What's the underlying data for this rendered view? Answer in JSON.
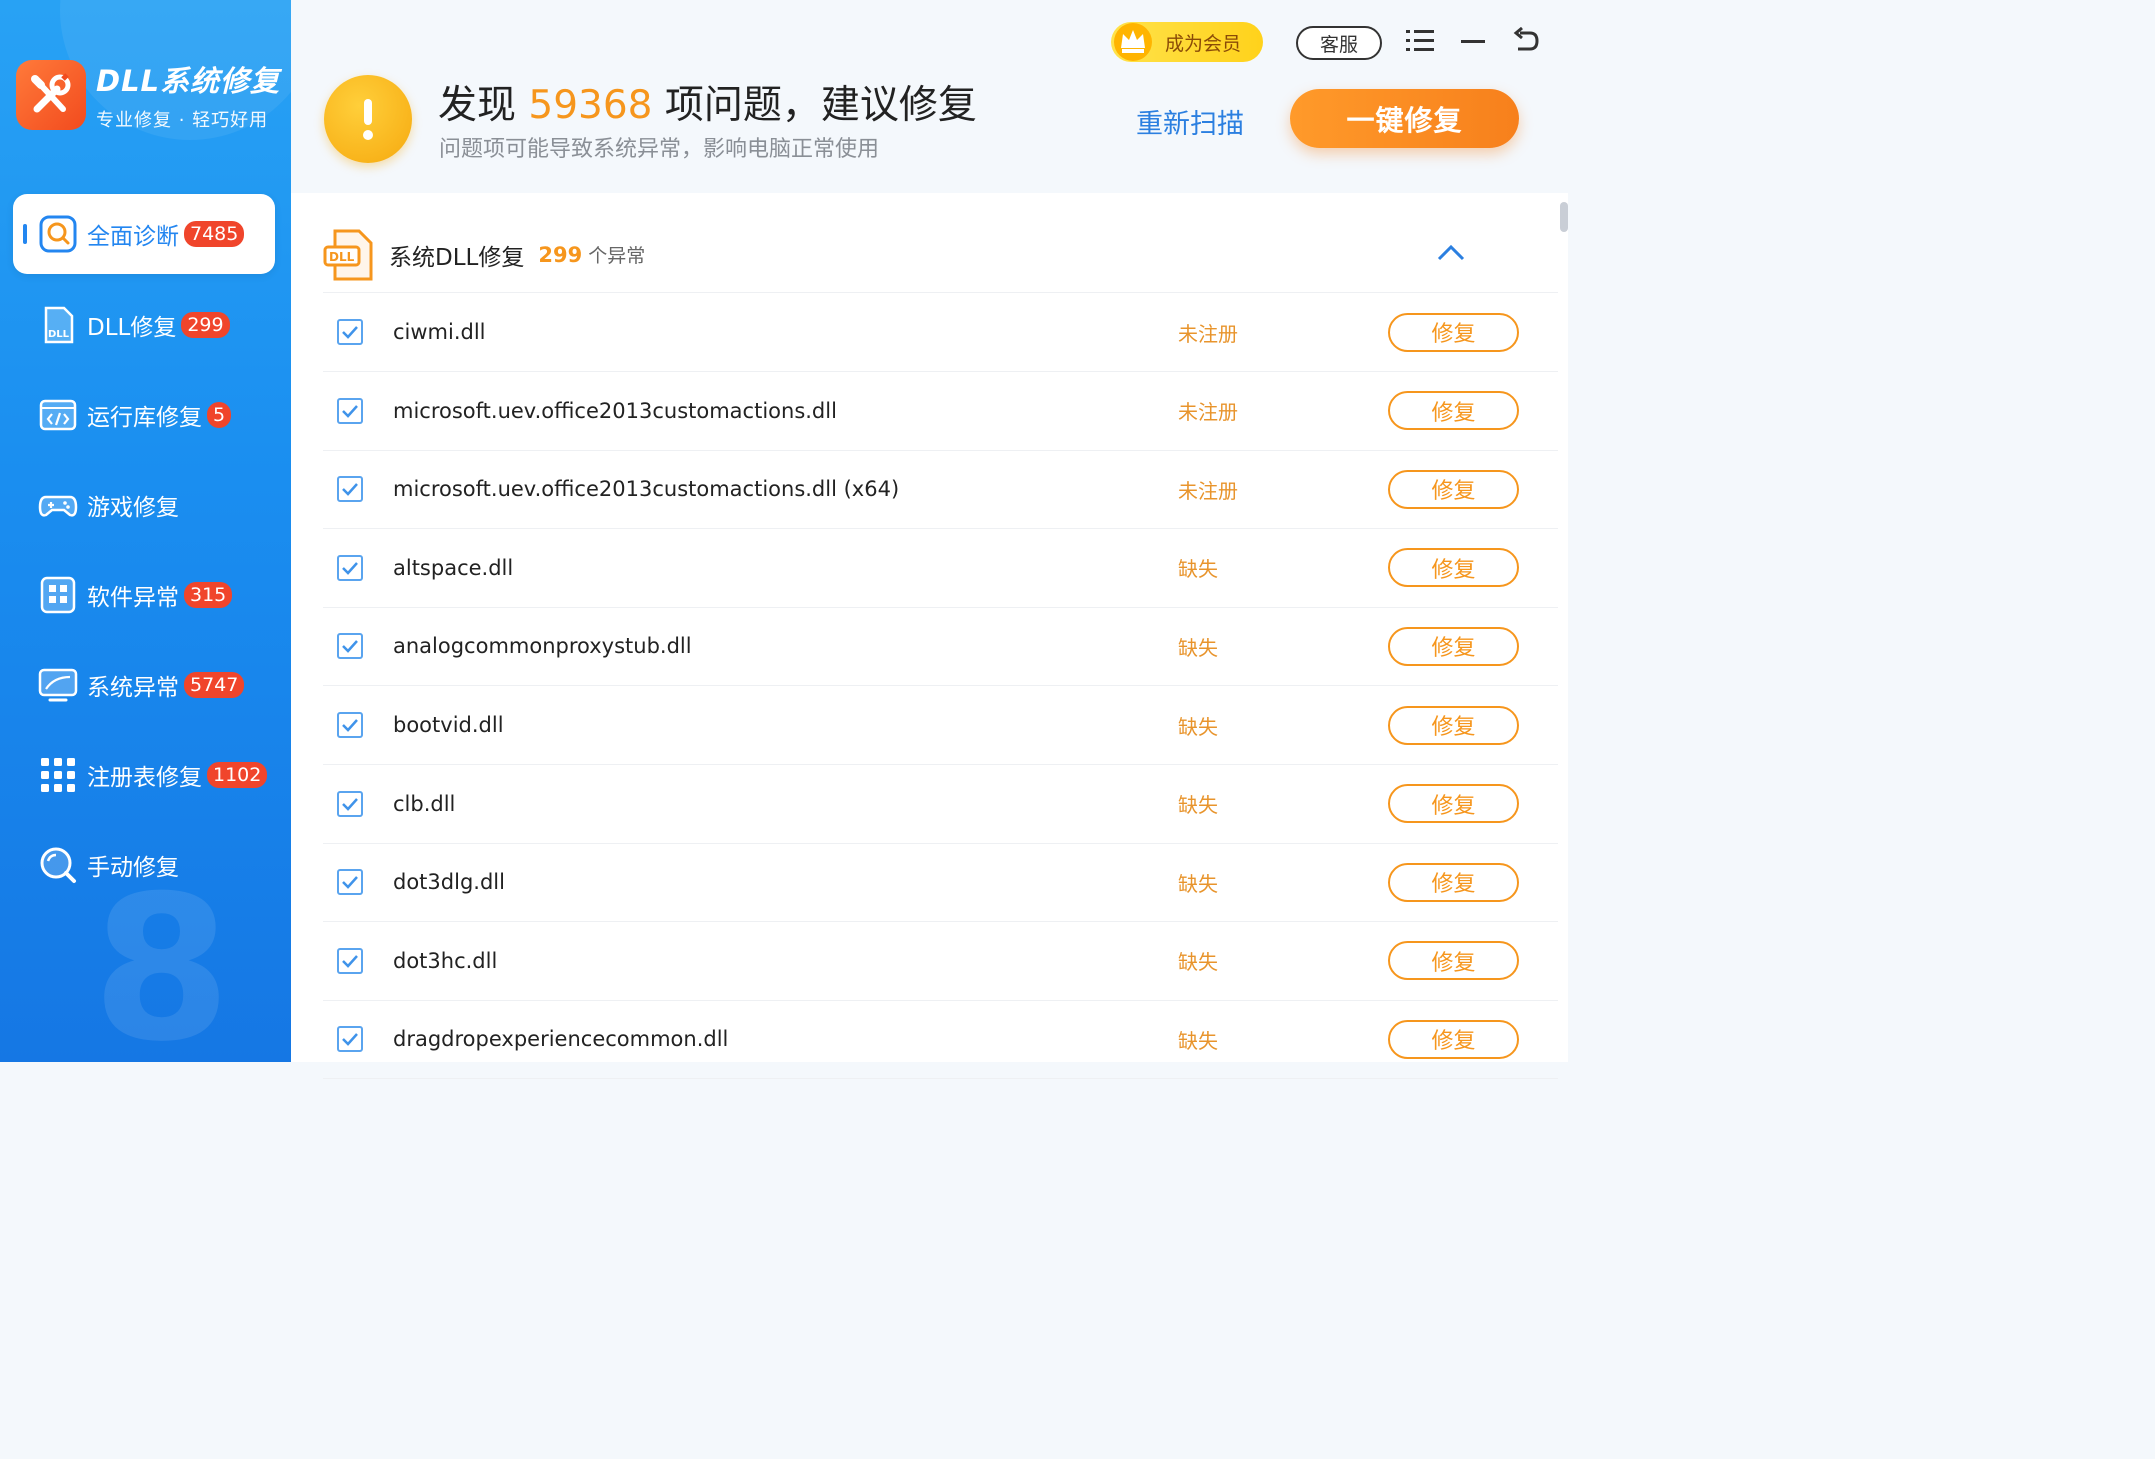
{
  "brand": {
    "title": "DLL系统修复",
    "subtitle": "专业修复 · 轻巧好用"
  },
  "sidebar": {
    "items": [
      {
        "label": "全面诊断",
        "badge": "7485",
        "icon": "scan-search-icon",
        "active": true
      },
      {
        "label": "DLL修复",
        "badge": "299",
        "icon": "dll-file-icon"
      },
      {
        "label": "运行库修复",
        "badge": "5",
        "icon": "code-window-icon"
      },
      {
        "label": "游戏修复",
        "badge": "",
        "icon": "gamepad-icon"
      },
      {
        "label": "软件异常",
        "badge": "315",
        "icon": "app-grid-icon"
      },
      {
        "label": "系统异常",
        "badge": "5747",
        "icon": "monitor-icon"
      },
      {
        "label": "注册表修复",
        "badge": "1102",
        "icon": "registry-grid-icon"
      },
      {
        "label": "手动修复",
        "badge": "",
        "icon": "magnifier-icon"
      }
    ],
    "decor_digit": "8"
  },
  "header": {
    "vip_label": "成为会员",
    "service_label": "客服",
    "headline_prefix": "发现",
    "problem_count": "59368",
    "headline_suffix": "项问题，建议修复",
    "subline": "问题项可能导致系统异常，影响电脑正常使用",
    "rescan_label": "重新扫描",
    "fix_all_label": "一键修复"
  },
  "section": {
    "icon_text": "DLL",
    "title": "系统DLL修复",
    "count": "299",
    "unit": "个异常"
  },
  "rows": [
    {
      "file": "ciwmi.dll",
      "status": "未注册",
      "action": "修复",
      "checked": true
    },
    {
      "file": "microsoft.uev.office2013customactions.dll",
      "status": "未注册",
      "action": "修复",
      "checked": true
    },
    {
      "file": "microsoft.uev.office2013customactions.dll (x64)",
      "status": "未注册",
      "action": "修复",
      "checked": true
    },
    {
      "file": "altspace.dll",
      "status": "缺失",
      "action": "修复",
      "checked": true
    },
    {
      "file": "analogcommonproxystub.dll",
      "status": "缺失",
      "action": "修复",
      "checked": true
    },
    {
      "file": "bootvid.dll",
      "status": "缺失",
      "action": "修复",
      "checked": true
    },
    {
      "file": "clb.dll",
      "status": "缺失",
      "action": "修复",
      "checked": true
    },
    {
      "file": "dot3dlg.dll",
      "status": "缺失",
      "action": "修复",
      "checked": true
    },
    {
      "file": "dot3hc.dll",
      "status": "缺失",
      "action": "修复",
      "checked": true
    },
    {
      "file": "dragdropexperiencecommon.dll",
      "status": "缺失",
      "action": "修复",
      "checked": true
    }
  ],
  "colors": {
    "accent_blue": "#2386f0",
    "accent_orange": "#f6961d",
    "badge_red": "#f0452b",
    "vip_yellow": "#ffd21b"
  }
}
